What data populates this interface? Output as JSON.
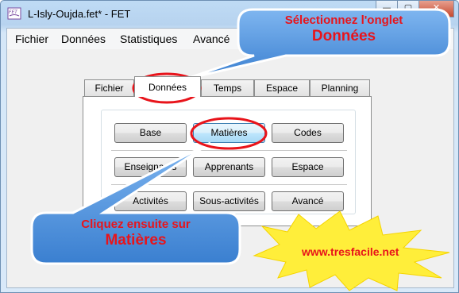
{
  "window": {
    "title": "L-Isly-Oujda.fet* - FET",
    "icon": "fet-app-icon",
    "controls": [
      "minimize-icon",
      "maximize-icon",
      "close-icon"
    ]
  },
  "menubar": {
    "items": [
      "Fichier",
      "Données",
      "Statistiques",
      "Avancé"
    ]
  },
  "tabs": {
    "items": [
      "Fichier",
      "Données",
      "Temps",
      "Espace",
      "Planning"
    ],
    "active": "Données"
  },
  "panel": {
    "buttons": [
      "Base",
      "Matières",
      "Codes",
      "Enseignants",
      "Apprenants",
      "Espace",
      "Activités",
      "Sous-activités",
      "Avancé"
    ],
    "hot_button": "Matières"
  },
  "annotations": {
    "callout_top_line1": "Sélectionnez l'onglet",
    "callout_top_line2": "Données",
    "callout_bottom_line1": "Cliquez ensuite sur",
    "callout_bottom_line2": "Matières",
    "promo": "www.tresfacile.net"
  },
  "colors": {
    "annotation_red": "#e8141b",
    "callout_blue": "#4d8fd9",
    "starburst_yellow": "#ffee3a",
    "titlebar": "#bfdbf5"
  }
}
